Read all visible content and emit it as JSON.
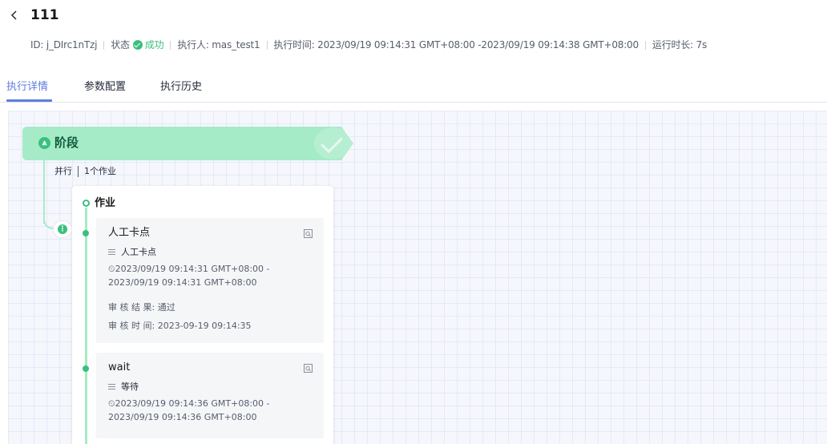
{
  "header": {
    "title": "111",
    "back_icon": "chevron-left-icon",
    "meta": {
      "id": "ID: j_DIrc1nTzj",
      "status_label": "状态",
      "status_value": "成功",
      "executor": "执行人: mas_test1",
      "exec_time": "执行时间: 2023/09/19 09:14:31 GMT+08:00 -2023/09/19 09:14:38 GMT+08:00",
      "duration": "运行时长: 7s"
    }
  },
  "tabs": [
    {
      "label": "执行详情",
      "active": true
    },
    {
      "label": "参数配置",
      "active": false
    },
    {
      "label": "执行历史",
      "active": false
    }
  ],
  "colors": {
    "accent": "#5e7ce0",
    "success": "#3ac07e",
    "stage_bar": "#a6ebc8"
  },
  "stage": {
    "icon": "stage-icon",
    "title": "阶段",
    "mode": "并行",
    "job_count": "1个作业"
  },
  "job": {
    "title": "作业",
    "tasks": [
      {
        "name": "人工卡点",
        "type": "人工卡点",
        "time": "⏲2023/09/19 09:14:31 GMT+08:00 - 2023/09/19 09:14:31 GMT+08:00",
        "review_result": "审 核 结 果: 通过",
        "review_time": "审 核 时 间: 2023-09-19 09:14:35"
      },
      {
        "name": "wait",
        "type": "等待",
        "time": "⏲2023/09/19 09:14:36 GMT+08:00 - 2023/09/19 09:14:36 GMT+08:00"
      }
    ]
  }
}
